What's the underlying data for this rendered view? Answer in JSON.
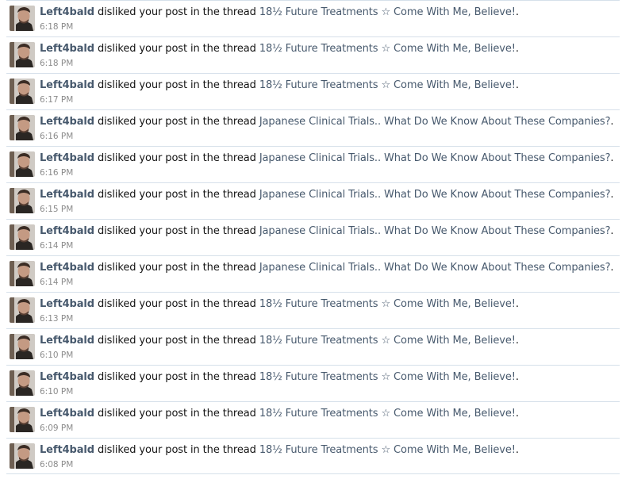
{
  "alerts": [
    {
      "user": "Left4bald",
      "action": "disliked your post in the thread",
      "thread": "18½ Future Treatments ☆ Come With Me, Believe!",
      "end": ".",
      "time": "6:18 PM"
    },
    {
      "user": "Left4bald",
      "action": "disliked your post in the thread",
      "thread": "18½ Future Treatments ☆ Come With Me, Believe!",
      "end": ".",
      "time": "6:18 PM"
    },
    {
      "user": "Left4bald",
      "action": "disliked your post in the thread",
      "thread": "18½ Future Treatments ☆ Come With Me, Believe!",
      "end": ".",
      "time": "6:17 PM"
    },
    {
      "user": "Left4bald",
      "action": "disliked your post in the thread",
      "thread": "Japanese Clinical Trials.. What Do We Know About These Companies?",
      "end": ".",
      "time": "6:16 PM"
    },
    {
      "user": "Left4bald",
      "action": "disliked your post in the thread",
      "thread": "Japanese Clinical Trials.. What Do We Know About These Companies?",
      "end": ".",
      "time": "6:16 PM"
    },
    {
      "user": "Left4bald",
      "action": "disliked your post in the thread",
      "thread": "Japanese Clinical Trials.. What Do We Know About These Companies?",
      "end": ".",
      "time": "6:15 PM"
    },
    {
      "user": "Left4bald",
      "action": "disliked your post in the thread",
      "thread": "Japanese Clinical Trials.. What Do We Know About These Companies?",
      "end": ".",
      "time": "6:14 PM"
    },
    {
      "user": "Left4bald",
      "action": "disliked your post in the thread",
      "thread": "Japanese Clinical Trials.. What Do We Know About These Companies?",
      "end": ".",
      "time": "6:14 PM"
    },
    {
      "user": "Left4bald",
      "action": "disliked your post in the thread",
      "thread": "18½ Future Treatments ☆ Come With Me, Believe!",
      "end": ".",
      "time": "6:13 PM"
    },
    {
      "user": "Left4bald",
      "action": "disliked your post in the thread",
      "thread": "18½ Future Treatments ☆ Come With Me, Believe!",
      "end": ".",
      "time": "6:10 PM"
    },
    {
      "user": "Left4bald",
      "action": "disliked your post in the thread",
      "thread": "18½ Future Treatments ☆ Come With Me, Believe!",
      "end": ".",
      "time": "6:10 PM"
    },
    {
      "user": "Left4bald",
      "action": "disliked your post in the thread",
      "thread": "18½ Future Treatments ☆ Come With Me, Believe!",
      "end": ".",
      "time": "6:09 PM"
    },
    {
      "user": "Left4bald",
      "action": "disliked your post in the thread",
      "thread": "18½ Future Treatments ☆ Come With Me, Believe!",
      "end": ".",
      "time": "6:08 PM"
    }
  ],
  "colors": {
    "link": "#47596d",
    "time": "#8c8c8c",
    "divider": "#d6e0ea"
  },
  "icons": {
    "avatar": "user-avatar-photo"
  }
}
